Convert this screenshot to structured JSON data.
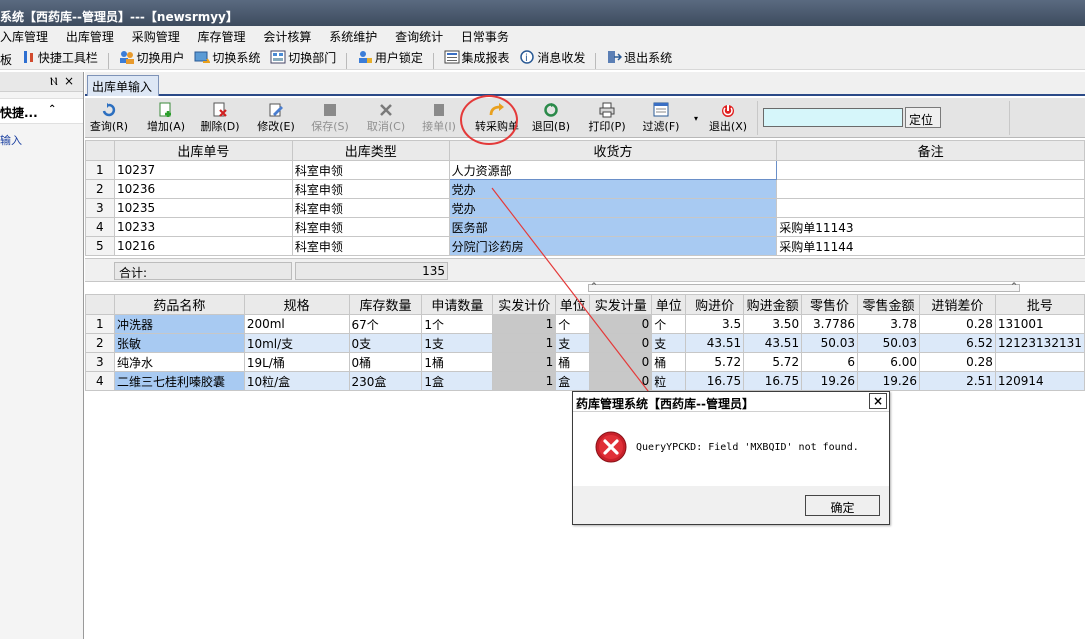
{
  "window": {
    "title": "系统【西药库--管理员】---【newsrmyy】"
  },
  "menu": [
    "入库管理",
    "出库管理",
    "采购管理",
    "库存管理",
    "会计核算",
    "系统维护",
    "查询统计",
    "日常事务"
  ],
  "quickbar": {
    "items": [
      {
        "label": "板",
        "icon": "board-icon"
      },
      {
        "label": "快捷工具栏",
        "icon": "quick-toolbar-icon"
      },
      {
        "label": "切换用户",
        "icon": "switch-user-icon"
      },
      {
        "label": "切换系统",
        "icon": "switch-system-icon"
      },
      {
        "label": "切换部门",
        "icon": "switch-dept-icon"
      },
      {
        "label": "用户锁定",
        "icon": "user-lock-icon"
      },
      {
        "label": "集成报表",
        "icon": "report-icon"
      },
      {
        "label": "消息收发",
        "icon": "message-icon"
      },
      {
        "label": "退出系统",
        "icon": "exit-system-icon"
      }
    ]
  },
  "leftpanel": {
    "pin": "Ⲛ",
    "close": "×",
    "group": "快捷...",
    "chevron": "⌃",
    "item": "输入"
  },
  "tab": {
    "label": "出库单输入"
  },
  "toolbar": {
    "buttons": [
      {
        "label": "查询(R)",
        "icon": "query-icon",
        "enabled": true
      },
      {
        "label": "增加(A)",
        "icon": "add-icon",
        "enabled": true
      },
      {
        "label": "删除(D)",
        "icon": "delete-icon",
        "enabled": true
      },
      {
        "label": "修改(E)",
        "icon": "edit-icon",
        "enabled": true
      },
      {
        "label": "保存(S)",
        "icon": "save-icon",
        "enabled": false
      },
      {
        "label": "取消(C)",
        "icon": "cancel-icon",
        "enabled": false
      },
      {
        "label": "接单(I)",
        "icon": "receive-order-icon",
        "enabled": false
      },
      {
        "label": "转采购单",
        "icon": "transfer-purchase-icon",
        "enabled": true
      },
      {
        "label": "退回(B)",
        "icon": "return-icon",
        "enabled": true
      },
      {
        "label": "打印(P)",
        "icon": "print-icon",
        "enabled": true
      },
      {
        "label": "过滤(F)",
        "icon": "filter-icon",
        "enabled": true
      },
      {
        "label": "退出(X)",
        "icon": "exit-icon",
        "enabled": true
      }
    ],
    "locate_label": "定位",
    "locate_value": "",
    "dropdown_caret": "▾"
  },
  "upper_grid": {
    "columns": [
      "",
      "出库单号",
      "出库类型",
      "收货方",
      "备注"
    ],
    "rows": [
      [
        "1",
        "10237",
        "科室申领",
        "人力资源部",
        ""
      ],
      [
        "2",
        "10236",
        "科室申领",
        "党办",
        ""
      ],
      [
        "3",
        "10235",
        "科室申领",
        "党办",
        ""
      ],
      [
        "4",
        "10233",
        "科室申领",
        "医务部",
        "采购单11143"
      ],
      [
        "5",
        "10216",
        "科室申领",
        "分院门诊药房",
        "采购单11144"
      ]
    ],
    "summary_label": "合计:",
    "summary_value": "135"
  },
  "splitter": {
    "left": "^",
    "right": "^"
  },
  "lower_grid": {
    "columns": [
      "",
      "药品名称",
      "规格",
      "库存数量",
      "申请数量",
      "实发计价",
      "单位",
      "实发计量",
      "单位",
      "购进价",
      "购进金额",
      "零售价",
      "零售金额",
      "进销差价",
      "批号"
    ],
    "rows": [
      [
        "1",
        "冲洗器",
        "200ml",
        "67个",
        "1个",
        "1",
        "个",
        "0",
        "个",
        "3.5",
        "3.50",
        "3.7786",
        "3.78",
        "0.28",
        "131001"
      ],
      [
        "2",
        "张敏",
        "10ml/支",
        "0支",
        "1支",
        "1",
        "支",
        "0",
        "支",
        "43.51",
        "43.51",
        "50.03",
        "50.03",
        "6.52",
        "12123132131"
      ],
      [
        "3",
        "纯净水",
        "19L/桶",
        "0桶",
        "1桶",
        "1",
        "桶",
        "0",
        "桶",
        "5.72",
        "5.72",
        "6",
        "6.00",
        "0.28",
        ""
      ],
      [
        "4",
        "二维三七桂利嗪胶囊",
        "10粒/盒",
        "230盒",
        "1盒",
        "1",
        "盒",
        "0",
        "粒",
        "16.75",
        "16.75",
        "19.26",
        "19.26",
        "2.51",
        "120914"
      ]
    ]
  },
  "dialog": {
    "title": "药库管理系统【西药库--管理员】",
    "close": "×",
    "message": "QueryYPCKD: Field 'MXBQID' not found.",
    "ok_label": "确定"
  },
  "colors": {
    "highlight": "#a8caf2",
    "annotation_red": "#e43a3a",
    "error_red": "#c8202a"
  }
}
